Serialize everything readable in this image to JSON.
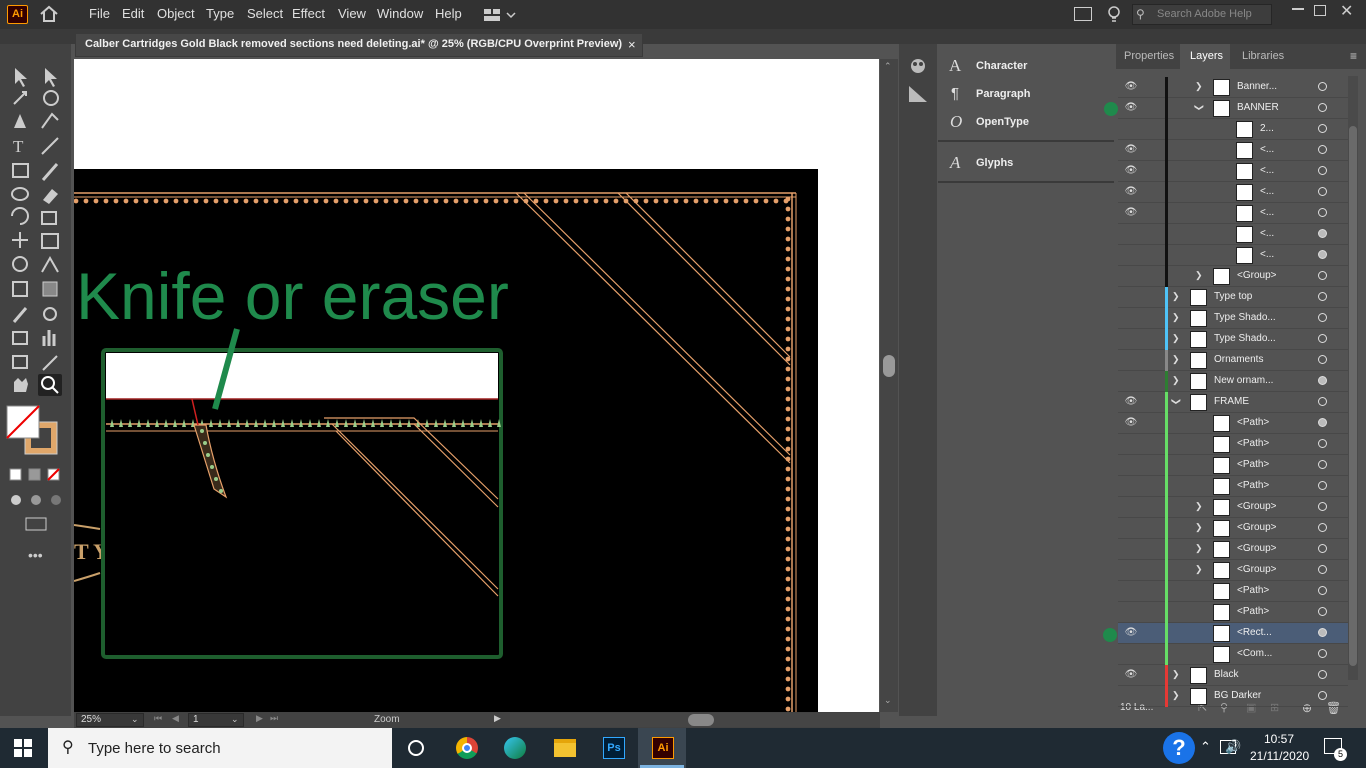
{
  "menubar": {
    "app_logo": "Ai",
    "items": [
      "File",
      "Edit",
      "Object",
      "Type",
      "Select",
      "Effect",
      "View",
      "Window",
      "Help"
    ],
    "search_placeholder": "Search Adobe Help"
  },
  "document": {
    "title": "Calber Cartridges Gold Black removed sections need deleting.ai* @ 25% (RGB/CPU Overprint Preview)",
    "close": "×"
  },
  "annotation": {
    "text": "Knife or eraser",
    "color": "#1f8a4c"
  },
  "statusbar": {
    "zoom": "25%",
    "page": "1",
    "mode": "Zoom"
  },
  "char_panel": {
    "items": [
      "Character",
      "Paragraph",
      "OpenType",
      "Glyphs"
    ]
  },
  "layers_panel": {
    "tabs": [
      "Properties",
      "Layers",
      "Libraries"
    ],
    "footer_count": "10 La...",
    "rows": [
      {
        "name": "Banner...",
        "eye": true,
        "arrow": "right",
        "indent": 2,
        "color": "#111111",
        "target": "hollow"
      },
      {
        "name": "BANNER",
        "eye": true,
        "arrow": "down",
        "indent": 2,
        "color": "#111111",
        "target": "hollow"
      },
      {
        "name": "2...",
        "eye": false,
        "arrow": "",
        "indent": 3,
        "color": "#111111",
        "target": "hollow"
      },
      {
        "name": "<...",
        "eye": true,
        "arrow": "",
        "indent": 3,
        "color": "#111111",
        "target": "hollow"
      },
      {
        "name": "<...",
        "eye": true,
        "arrow": "",
        "indent": 3,
        "color": "#111111",
        "target": "hollow"
      },
      {
        "name": "<...",
        "eye": true,
        "arrow": "",
        "indent": 3,
        "color": "#111111",
        "target": "hollow"
      },
      {
        "name": "<...",
        "eye": true,
        "arrow": "",
        "indent": 3,
        "color": "#111111",
        "target": "hollow"
      },
      {
        "name": "<...",
        "eye": false,
        "arrow": "",
        "indent": 3,
        "color": "#111111",
        "target": "filled"
      },
      {
        "name": "<...",
        "eye": false,
        "arrow": "",
        "indent": 3,
        "color": "#111111",
        "target": "filled"
      },
      {
        "name": "<Group>",
        "eye": false,
        "arrow": "right",
        "indent": 2,
        "color": "#111111",
        "target": "hollow"
      },
      {
        "name": "Type top",
        "eye": false,
        "arrow": "right",
        "indent": 1,
        "color": "#4fc3f7",
        "target": "hollow"
      },
      {
        "name": "Type Shado...",
        "eye": false,
        "arrow": "right",
        "indent": 1,
        "color": "#4fc3f7",
        "target": "hollow"
      },
      {
        "name": "Type Shado...",
        "eye": false,
        "arrow": "right",
        "indent": 1,
        "color": "#4fc3f7",
        "target": "hollow"
      },
      {
        "name": "Ornaments",
        "eye": false,
        "arrow": "right",
        "indent": 1,
        "color": "#888888",
        "target": "hollow"
      },
      {
        "name": "New ornam...",
        "eye": false,
        "arrow": "right",
        "indent": 1,
        "color": "#2e7d32",
        "target": "filled"
      },
      {
        "name": "FRAME",
        "eye": true,
        "arrow": "down",
        "indent": 1,
        "color": "#66dd66",
        "target": "hollow"
      },
      {
        "name": "<Path>",
        "eye": true,
        "arrow": "",
        "indent": 2,
        "color": "#66dd66",
        "target": "filled"
      },
      {
        "name": "<Path>",
        "eye": false,
        "arrow": "",
        "indent": 2,
        "color": "#66dd66",
        "target": "hollow"
      },
      {
        "name": "<Path>",
        "eye": false,
        "arrow": "",
        "indent": 2,
        "color": "#66dd66",
        "target": "hollow"
      },
      {
        "name": "<Path>",
        "eye": false,
        "arrow": "",
        "indent": 2,
        "color": "#66dd66",
        "target": "hollow"
      },
      {
        "name": "<Group>",
        "eye": false,
        "arrow": "right",
        "indent": 2,
        "color": "#66dd66",
        "target": "hollow"
      },
      {
        "name": "<Group>",
        "eye": false,
        "arrow": "right",
        "indent": 2,
        "color": "#66dd66",
        "target": "hollow"
      },
      {
        "name": "<Group>",
        "eye": false,
        "arrow": "right",
        "indent": 2,
        "color": "#66dd66",
        "target": "hollow"
      },
      {
        "name": "<Group>",
        "eye": false,
        "arrow": "right",
        "indent": 2,
        "color": "#66dd66",
        "target": "hollow"
      },
      {
        "name": "<Path>",
        "eye": false,
        "arrow": "",
        "indent": 2,
        "color": "#66dd66",
        "target": "hollow"
      },
      {
        "name": "<Path>",
        "eye": false,
        "arrow": "",
        "indent": 2,
        "color": "#66dd66",
        "target": "hollow"
      },
      {
        "name": "<Rect...",
        "eye": true,
        "arrow": "",
        "indent": 2,
        "color": "#66dd66",
        "target": "filled",
        "selected": true
      },
      {
        "name": "<Com...",
        "eye": false,
        "arrow": "",
        "indent": 2,
        "color": "#66dd66",
        "target": "hollow"
      },
      {
        "name": "Black",
        "eye": true,
        "arrow": "right",
        "indent": 1,
        "color": "#e53935",
        "target": "hollow"
      },
      {
        "name": "BG Darker",
        "eye": false,
        "arrow": "right",
        "indent": 1,
        "color": "#e53935",
        "target": "hollow"
      }
    ]
  },
  "taskbar": {
    "search_placeholder": "Type here to search",
    "time": "10:57",
    "date": "21/11/2020",
    "notifications": "5"
  }
}
